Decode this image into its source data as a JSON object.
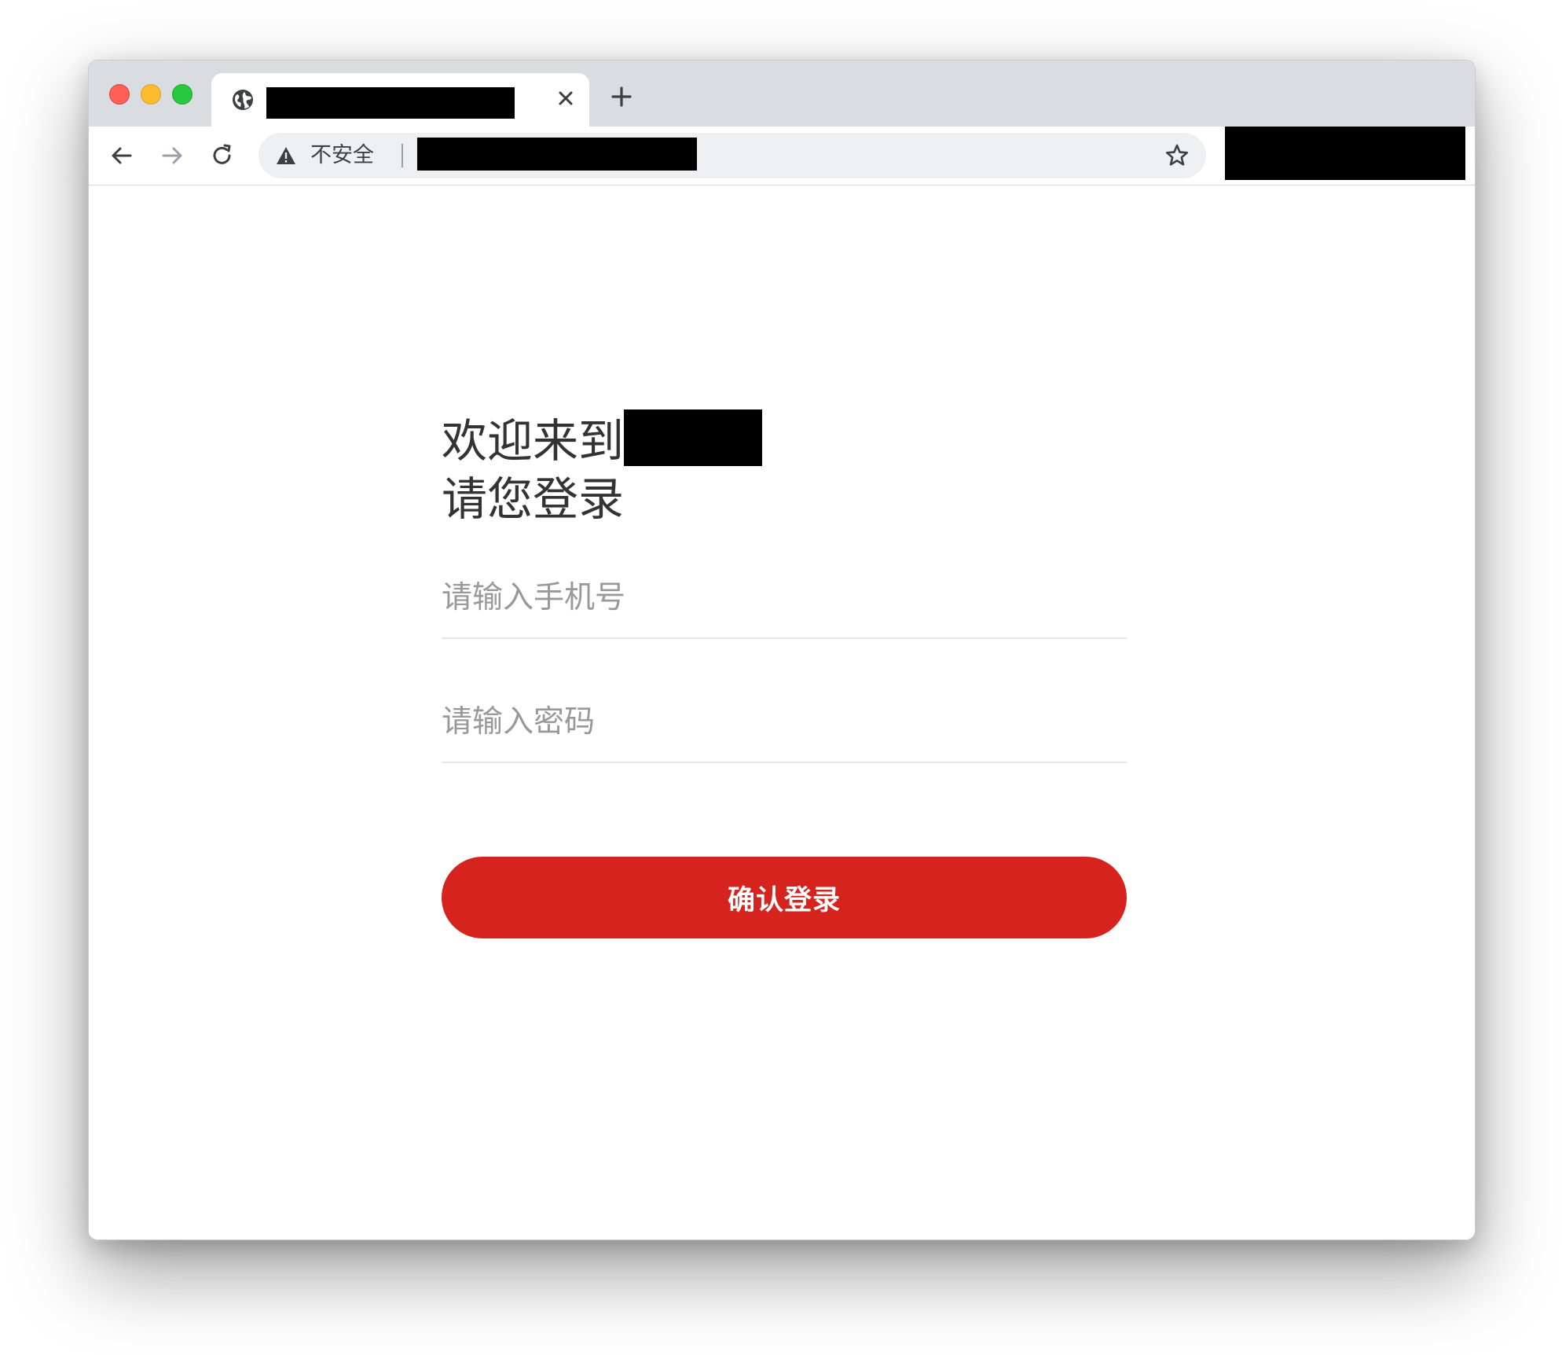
{
  "browser": {
    "tab": {
      "icon": "globe-icon",
      "close_icon": "close-icon"
    },
    "new_tab_icon": "plus-icon",
    "toolbar": {
      "back_icon": "arrow-left-icon",
      "forward_icon": "arrow-right-icon",
      "reload_icon": "reload-icon",
      "security_icon": "warning-icon",
      "security_label": "不安全",
      "bookmark_icon": "star-icon"
    }
  },
  "login": {
    "heading_line1": "欢迎来到",
    "heading_line2": "请您登录",
    "phone_placeholder": "请输入手机号",
    "phone_value": "",
    "password_placeholder": "请输入密码",
    "password_value": "",
    "submit_label": "确认登录"
  },
  "colors": {
    "accent": "#d7231e",
    "heading_text": "#333333",
    "placeholder_text": "#999999",
    "field_underline": "#e6e6e6"
  }
}
